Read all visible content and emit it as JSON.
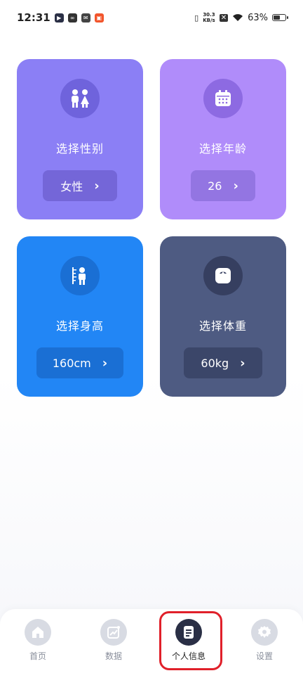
{
  "status_bar": {
    "time": "12:31",
    "net_speed_top": "30.3",
    "net_speed_bottom": "KB/s",
    "battery": "63%",
    "battery_level": 0.63
  },
  "cards": {
    "gender": {
      "title": "选择性别",
      "value": "女性",
      "icon": "gender-icon",
      "color": "#8b7ff5"
    },
    "age": {
      "title": "选择年龄",
      "value": "26",
      "icon": "calendar-icon",
      "color": "#b08cfa"
    },
    "height": {
      "title": "选择身高",
      "value": "160cm",
      "icon": "height-icon",
      "color": "#2286f5"
    },
    "weight": {
      "title": "选择体重",
      "value": "60kg",
      "icon": "scale-icon",
      "color": "#4e5b82"
    }
  },
  "nav": {
    "home": "首页",
    "data": "数据",
    "profile": "个人信息",
    "settings": "设置",
    "active": "profile"
  },
  "colors": {
    "highlight": "#e0202a",
    "nav_active": "#2a2f45"
  }
}
